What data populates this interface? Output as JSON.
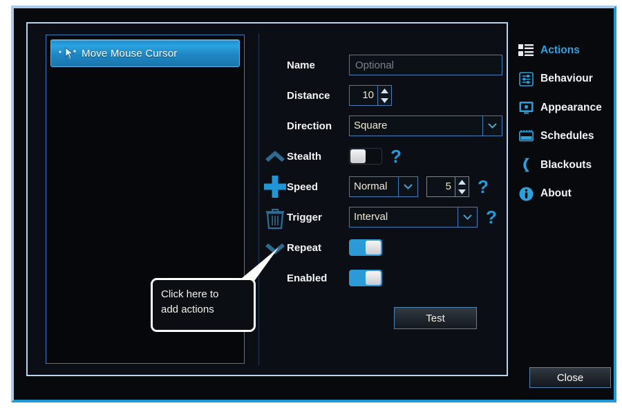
{
  "window": {
    "frame_color_light": "#a9cdeb",
    "frame_color_accent": "#1e9bd7",
    "background": "#07090d"
  },
  "actions_list": {
    "items": [
      {
        "label": "Move Mouse Cursor",
        "icon": "mouse-cursor-icon",
        "selected": true
      }
    ]
  },
  "list_toolbar": {
    "move_up": "move-up-icon",
    "add": "add-icon",
    "delete": "delete-icon",
    "move_down": "move-down-icon"
  },
  "callout": {
    "line1": "Click here to",
    "line2": "add actions"
  },
  "form": {
    "name": {
      "label": "Name",
      "value": "",
      "placeholder": "Optional"
    },
    "distance": {
      "label": "Distance",
      "value": "10"
    },
    "direction": {
      "label": "Direction",
      "value": "Square"
    },
    "stealth": {
      "label": "Stealth",
      "state": "off",
      "help": "?"
    },
    "speed": {
      "label": "Speed",
      "value": "Normal",
      "amount": "5",
      "help": "?"
    },
    "trigger": {
      "label": "Trigger",
      "value": "Interval",
      "help": "?"
    },
    "repeat": {
      "label": "Repeat",
      "state": "on"
    },
    "enabled": {
      "label": "Enabled",
      "state": "on"
    },
    "test_button": "Test"
  },
  "sidebar": {
    "items": [
      {
        "label": "Actions",
        "icon": "list-blocks-icon",
        "active": true
      },
      {
        "label": "Behaviour",
        "icon": "sliders-icon",
        "active": false
      },
      {
        "label": "Appearance",
        "icon": "monitor-icon",
        "active": false
      },
      {
        "label": "Schedules",
        "icon": "calendar-icon",
        "active": false
      },
      {
        "label": "Blackouts",
        "icon": "moon-icon",
        "active": false
      },
      {
        "label": "About",
        "icon": "info-icon",
        "active": false
      }
    ]
  },
  "footer": {
    "close_button": "Close"
  }
}
